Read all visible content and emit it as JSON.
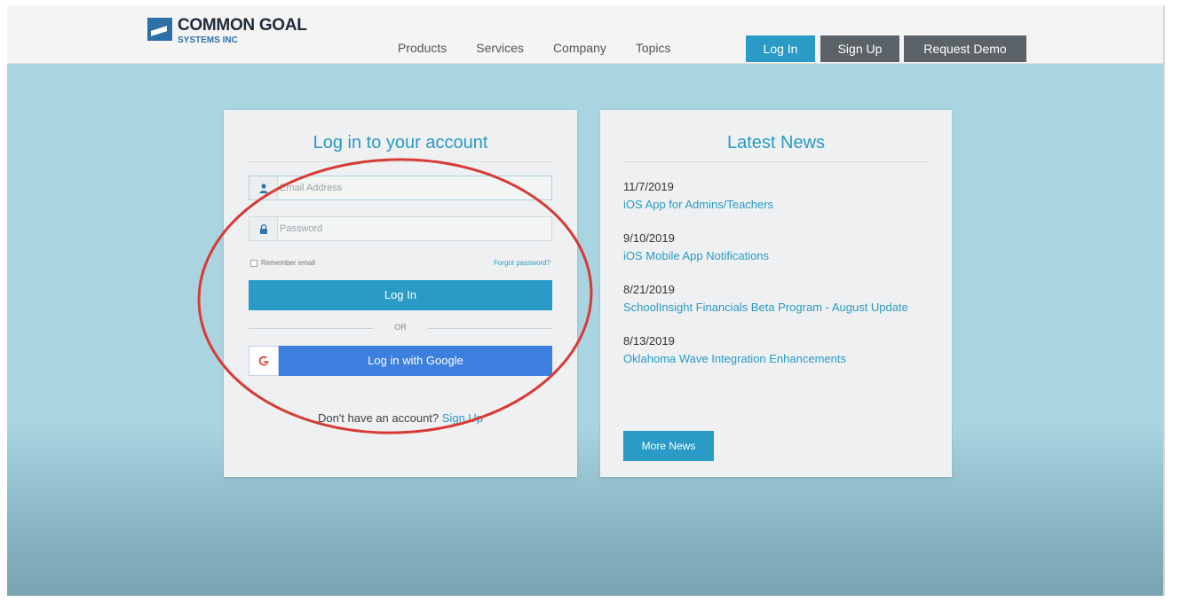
{
  "header": {
    "logo_name": "COMMON GOAL",
    "logo_sub": "SYSTEMS INC",
    "nav": [
      "Products",
      "Services",
      "Company",
      "Topics"
    ],
    "login_label": "Log In",
    "signup_label": "Sign Up",
    "demo_label": "Request Demo"
  },
  "login": {
    "title": "Log in to your account",
    "email_placeholder": "Email Address",
    "password_placeholder": "Password",
    "remember_label": "Remember email",
    "forgot_label": "Forgot password?",
    "submit_label": "Log In",
    "or_label": "OR",
    "google_label": "Log in with Google",
    "no_account_text": "Don't have an account?",
    "signup_link": "Sign Up"
  },
  "news": {
    "title": "Latest News",
    "items": [
      {
        "date": "11/7/2019",
        "title": "iOS App for Admins/Teachers"
      },
      {
        "date": "9/10/2019",
        "title": "iOS Mobile App Notifications"
      },
      {
        "date": "8/21/2019",
        "title": "SchoolInsight Financials Beta Program - August Update"
      },
      {
        "date": "8/13/2019",
        "title": "Oklahoma Wave Integration Enhancements"
      }
    ],
    "more_label": "More News"
  },
  "colors": {
    "accent": "#2a9ac6",
    "hero_bg": "#a9d4e0",
    "dark_button": "#5b6368",
    "google_blue": "#3d7fde",
    "annotation_red": "#d83a36"
  }
}
